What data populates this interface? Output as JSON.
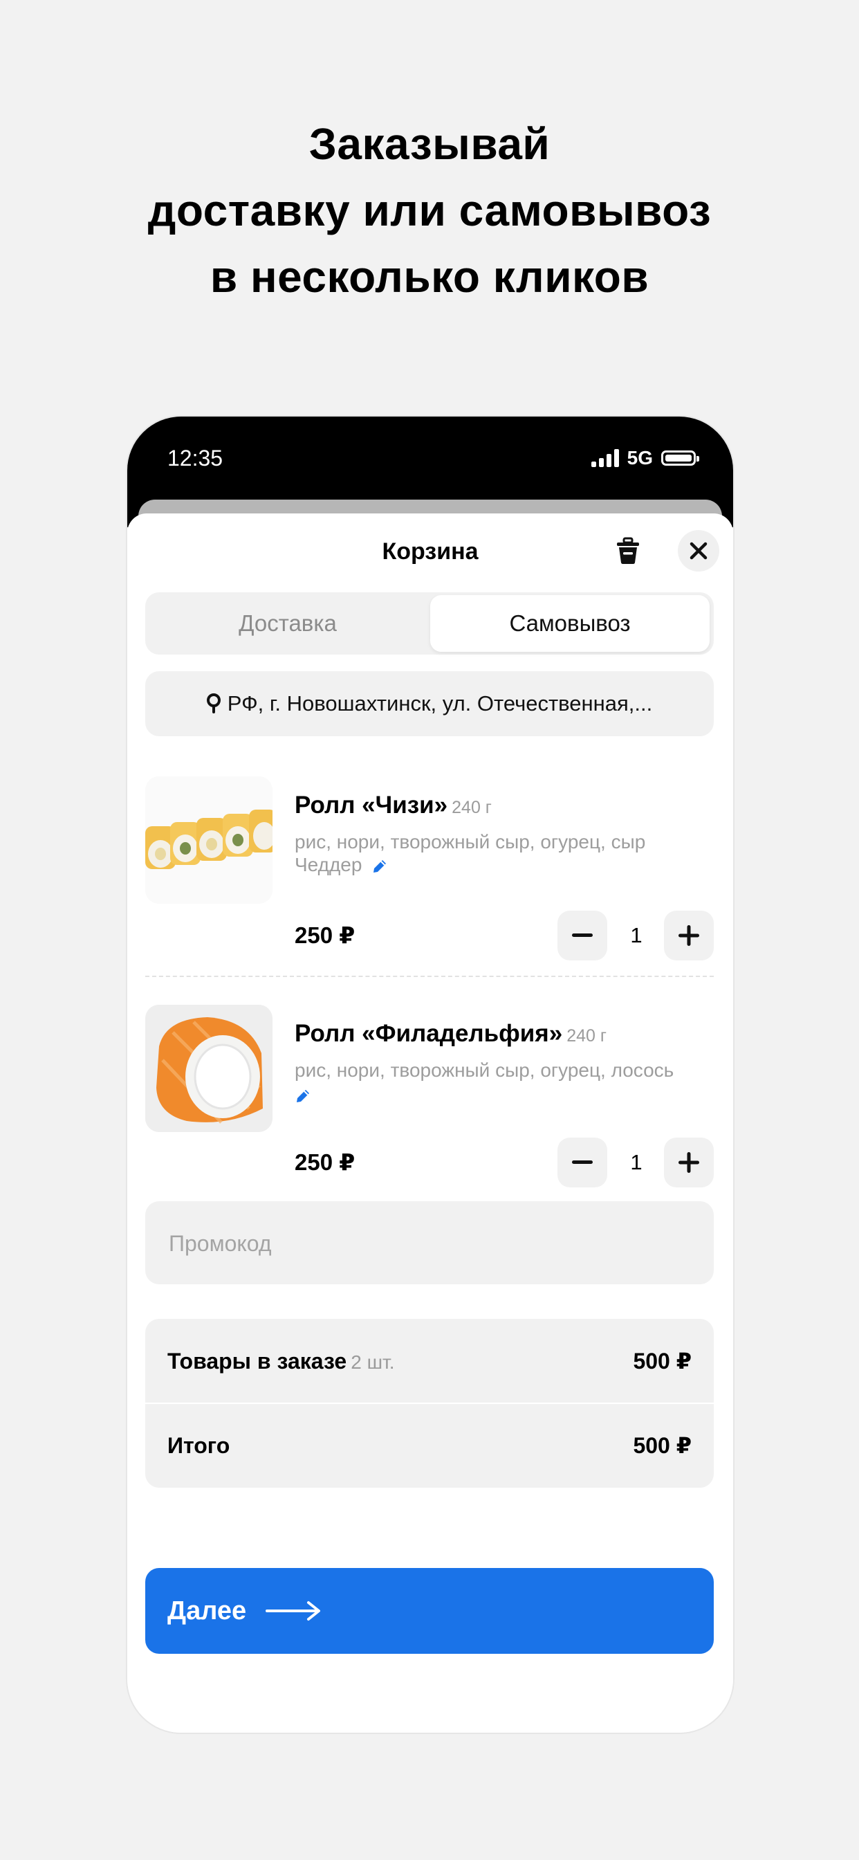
{
  "headline": {
    "line1": "Заказывай",
    "line2": "доставку или самовывоз",
    "line3": "в несколько кликов"
  },
  "status_bar": {
    "time": "12:35",
    "network": "5G"
  },
  "cart": {
    "title": "Корзина",
    "tabs": [
      {
        "label": "Доставка",
        "selected": false
      },
      {
        "label": "Самовывоз",
        "selected": true
      }
    ],
    "address": "РФ, г. Новошахтинск, ул. Отечественная,...",
    "items": [
      {
        "name": "Ролл «Чизи»",
        "weight": "240 г",
        "description": "рис, нори, творожный сыр, огурец, сыр Чеддер",
        "price": "250 ₽",
        "quantity": "1"
      },
      {
        "name": "Ролл «Филадельфия»",
        "weight": "240 г",
        "description": "рис, нори, творожный сыр, огурец, лосось",
        "price": "250 ₽",
        "quantity": "1"
      }
    ],
    "promo_placeholder": "Промокод",
    "summary": {
      "items_label": "Товары в заказе",
      "items_count": "2 шт.",
      "items_total": "500 ₽",
      "total_label": "Итого",
      "total_value": "500 ₽"
    },
    "next_button": "Далее"
  },
  "colors": {
    "accent": "#1a73e8",
    "background": "#f2f2f2",
    "field_bg": "#f1f1f1"
  }
}
